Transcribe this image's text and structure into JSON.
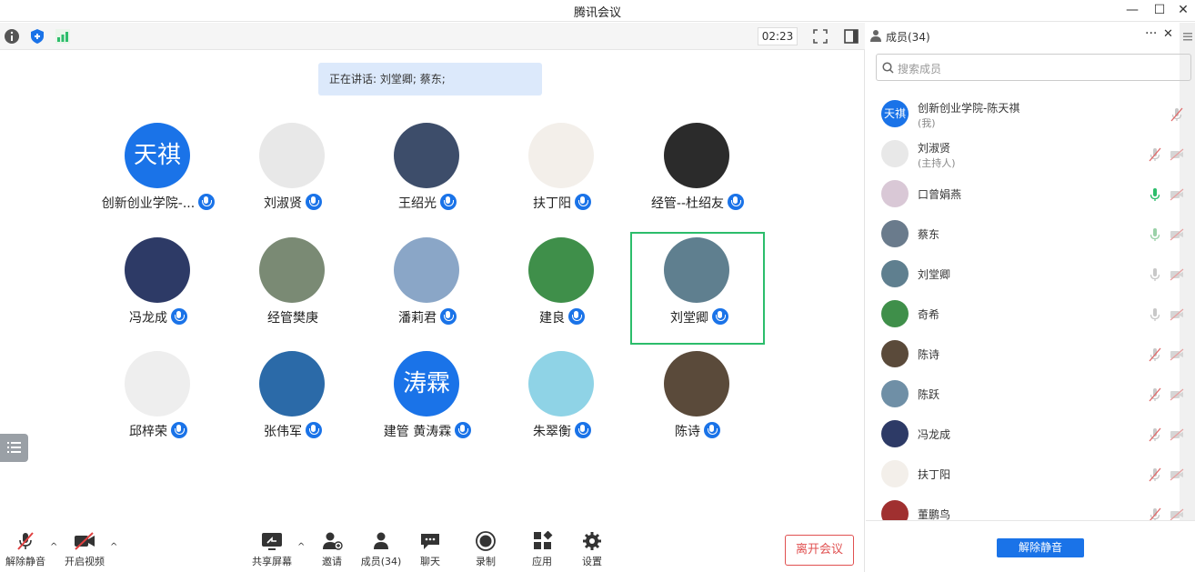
{
  "window": {
    "title": "腾讯会议",
    "minimize": "—",
    "maximize": "☐",
    "close": "✕"
  },
  "toolbar_top": {
    "timer": "02:23"
  },
  "speaking": {
    "text": "正在讲话: 刘堂卿; 蔡东;"
  },
  "colors": {
    "accent": "#1a73e8",
    "active_border": "#2cbd6b",
    "leave": "#e05050"
  },
  "grid": {
    "tiles": [
      {
        "name": "创新创业学院-...",
        "avatar_text": "天祺",
        "avatar_color": "#1a73e8"
      },
      {
        "name": "刘淑贤",
        "avatar_text": "",
        "avatar_color": "#e8e8e8"
      },
      {
        "name": "王绍光",
        "avatar_text": "",
        "avatar_color": "#3d4d6a"
      },
      {
        "name": "扶丁阳",
        "avatar_text": "",
        "avatar_color": "#f3efea"
      },
      {
        "name": "经管--杜绍友",
        "avatar_text": "",
        "avatar_color": "#2b2b2b"
      },
      {
        "name": "冯龙成",
        "avatar_text": "",
        "avatar_color": "#2d3a66"
      },
      {
        "name": "经管樊庚",
        "avatar_text": "",
        "avatar_color": "#7a8a74",
        "no_mic": true
      },
      {
        "name": "潘莉君",
        "avatar_text": "",
        "avatar_color": "#8aa6c7"
      },
      {
        "name": "建良",
        "avatar_text": "",
        "avatar_color": "#3f8f4a"
      },
      {
        "name": "刘堂卿",
        "avatar_text": "",
        "avatar_color": "#5f7f8f",
        "active": true
      },
      {
        "name": "邱梓荣",
        "avatar_text": "",
        "avatar_color": "#eee"
      },
      {
        "name": "张伟军",
        "avatar_text": "",
        "avatar_color": "#2b6aa8"
      },
      {
        "name": "建管 黄涛霖",
        "avatar_text": "涛霖",
        "avatar_color": "#1a73e8"
      },
      {
        "name": "朱翠衡",
        "avatar_text": "",
        "avatar_color": "#8fd3e6"
      },
      {
        "name": "陈诗",
        "avatar_text": "",
        "avatar_color": "#5a4a3a"
      }
    ]
  },
  "bottom": {
    "unmute": "解除静音",
    "start_video": "开启视频",
    "share": "共享屏幕",
    "invite": "邀请",
    "members": "成员(34)",
    "chat": "聊天",
    "record": "录制",
    "apps": "应用",
    "settings": "设置",
    "leave": "离开会议"
  },
  "panel": {
    "title": "成员(34)",
    "more": "···",
    "close": "✕",
    "search_placeholder": "搜索成员",
    "unmute_all": "解除静音",
    "members": [
      {
        "name": "创新创业学院-陈天祺",
        "role": "(我)",
        "avatar_text": "天祺",
        "avatar_color": "#1a73e8",
        "mic": "off-grey",
        "video": false
      },
      {
        "name": "刘淑贤",
        "role": "(主持人)",
        "avatar_text": "",
        "avatar_color": "#e8e8e8",
        "mic": "muted",
        "video": true
      },
      {
        "name": "口曾娟燕",
        "role": "",
        "avatar_text": "",
        "avatar_color": "#d9c8d6",
        "mic": "green",
        "video": true
      },
      {
        "name": "蔡东",
        "role": "",
        "avatar_text": "",
        "avatar_color": "#6a7b8c",
        "mic": "speaking",
        "video": true
      },
      {
        "name": "刘堂卿",
        "role": "",
        "avatar_text": "",
        "avatar_color": "#5f7f8f",
        "mic": "grey",
        "video": true
      },
      {
        "name": "奇希",
        "role": "",
        "avatar_text": "",
        "avatar_color": "#3f8f4a",
        "mic": "grey",
        "video": true
      },
      {
        "name": "陈诗",
        "role": "",
        "avatar_text": "",
        "avatar_color": "#5a4a3a",
        "mic": "muted",
        "video": true
      },
      {
        "name": "陈跃",
        "role": "",
        "avatar_text": "",
        "avatar_color": "#6f8fa6",
        "mic": "muted",
        "video": true
      },
      {
        "name": "冯龙成",
        "role": "",
        "avatar_text": "",
        "avatar_color": "#2d3a66",
        "mic": "muted",
        "video": true
      },
      {
        "name": "扶丁阳",
        "role": "",
        "avatar_text": "",
        "avatar_color": "#f3efea",
        "mic": "muted",
        "video": true
      },
      {
        "name": "董鹏鸟",
        "role": "",
        "avatar_text": "",
        "avatar_color": "#a03030",
        "mic": "muted",
        "video": true
      }
    ]
  }
}
